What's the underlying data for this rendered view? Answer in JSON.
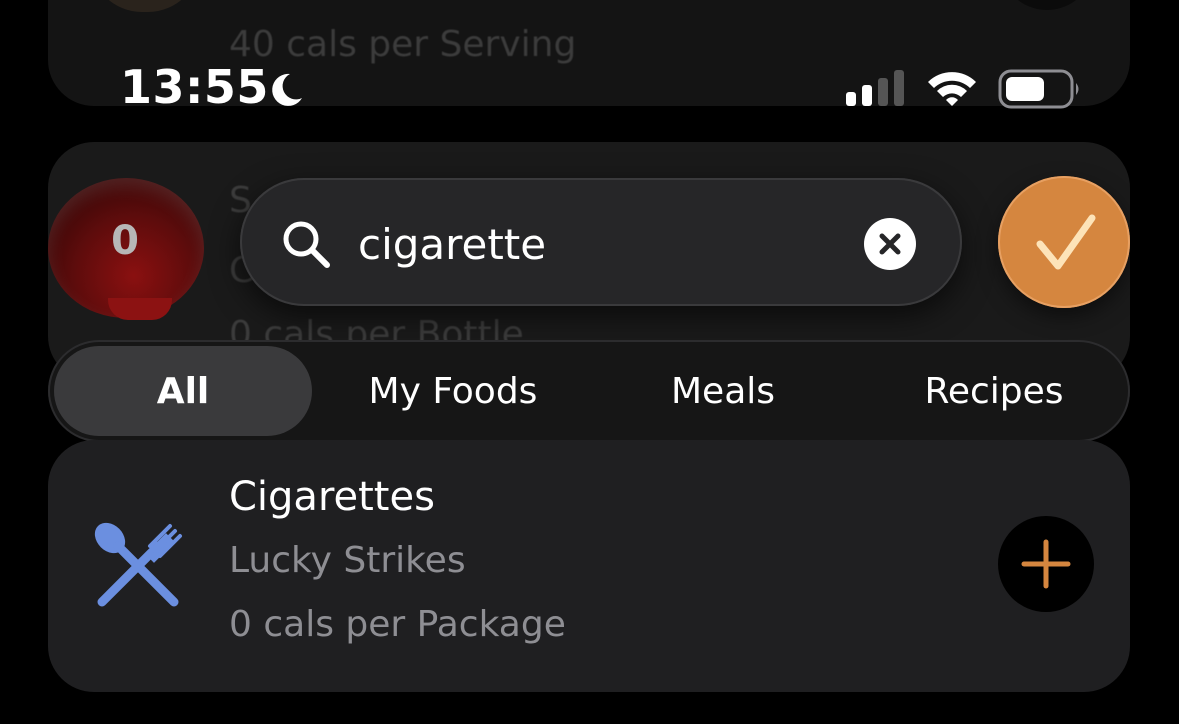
{
  "status_bar": {
    "time": "13:55",
    "focus_icon": "moon-icon",
    "signal_icon": "cellular-signal-icon",
    "wifi_icon": "wifi-icon",
    "battery_icon": "battery-icon"
  },
  "background_list": {
    "top_item_cals": "40 cals per Serving",
    "mid_item_title": "S",
    "mid_item_subtitle": "C",
    "mid_item_cals": "0 cals per Bottle",
    "mid_item_count": "0"
  },
  "search": {
    "value": "cigarette",
    "search_icon": "search-icon",
    "clear_icon": "clear-icon"
  },
  "confirm": {
    "icon": "checkmark-icon",
    "color": "#d5863f"
  },
  "tabs": [
    {
      "label": "All",
      "active": true
    },
    {
      "label": "My Foods",
      "active": false
    },
    {
      "label": "Meals",
      "active": false
    },
    {
      "label": "Recipes",
      "active": false
    }
  ],
  "result": {
    "title": "Cigarettes",
    "brand": "Lucky Strikes",
    "cals": "0 cals per Package",
    "icon": "utensils-icon",
    "icon_color": "#6b8fe0",
    "add_icon": "plus-icon",
    "accent_color": "#d5863f"
  }
}
